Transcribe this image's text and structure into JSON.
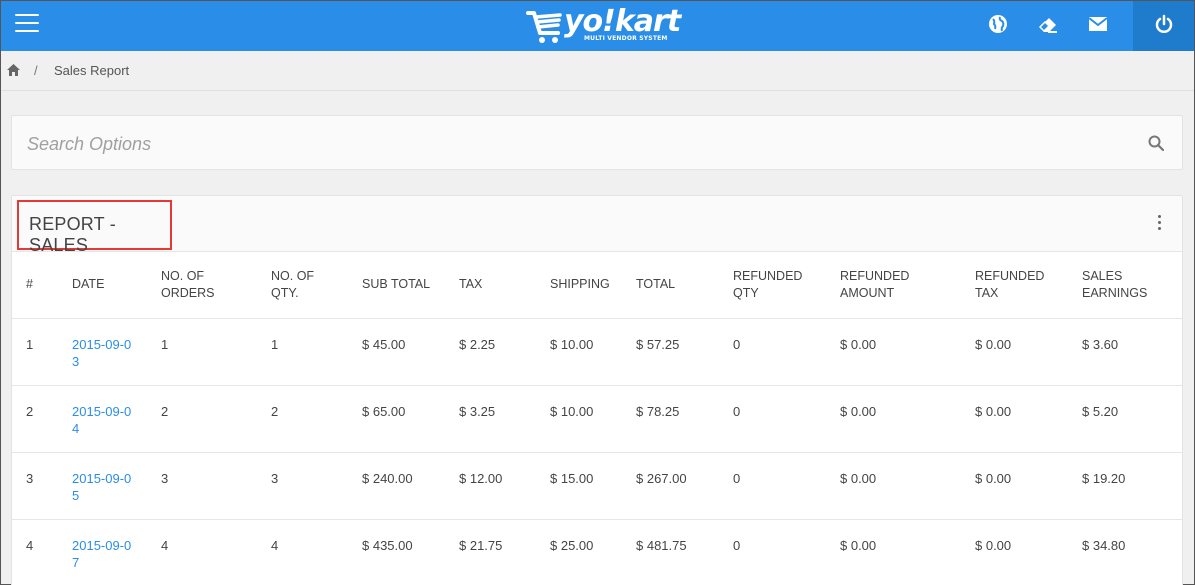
{
  "header": {
    "logo_text": "yo!kart",
    "logo_tagline": "MULTI VENDOR SYSTEM",
    "icons": [
      "globe-icon",
      "eraser-icon",
      "mail-icon",
      "power-icon"
    ],
    "brand_color": "#2a8ee8"
  },
  "breadcrumb": {
    "separator": "/",
    "current": "Sales Report"
  },
  "search": {
    "placeholder": "Search Options"
  },
  "report": {
    "title": "REPORT - SALES",
    "columns": [
      "#",
      "DATE",
      "NO. OF ORDERS",
      "NO. OF QTY.",
      "SUB TOTAL",
      "TAX",
      "SHIPPING",
      "TOTAL",
      "REFUNDED QTY",
      "REFUNDED AMOUNT",
      "REFUNDED TAX",
      "SALES EARNINGS"
    ],
    "rows": [
      [
        "1",
        "2015-09-03",
        "1",
        "1",
        "$ 45.00",
        "$ 2.25",
        "$ 10.00",
        "$ 57.25",
        "0",
        "$ 0.00",
        "$ 0.00",
        "$ 3.60"
      ],
      [
        "2",
        "2015-09-04",
        "2",
        "2",
        "$ 65.00",
        "$ 3.25",
        "$ 10.00",
        "$ 78.25",
        "0",
        "$ 0.00",
        "$ 0.00",
        "$ 5.20"
      ],
      [
        "3",
        "2015-09-05",
        "3",
        "3",
        "$ 240.00",
        "$ 12.00",
        "$ 15.00",
        "$ 267.00",
        "0",
        "$ 0.00",
        "$ 0.00",
        "$ 19.20"
      ],
      [
        "4",
        "2015-09-07",
        "4",
        "4",
        "$ 435.00",
        "$ 21.75",
        "$ 25.00",
        "$ 481.75",
        "0",
        "$ 0.00",
        "$ 0.00",
        "$ 34.80"
      ]
    ]
  }
}
